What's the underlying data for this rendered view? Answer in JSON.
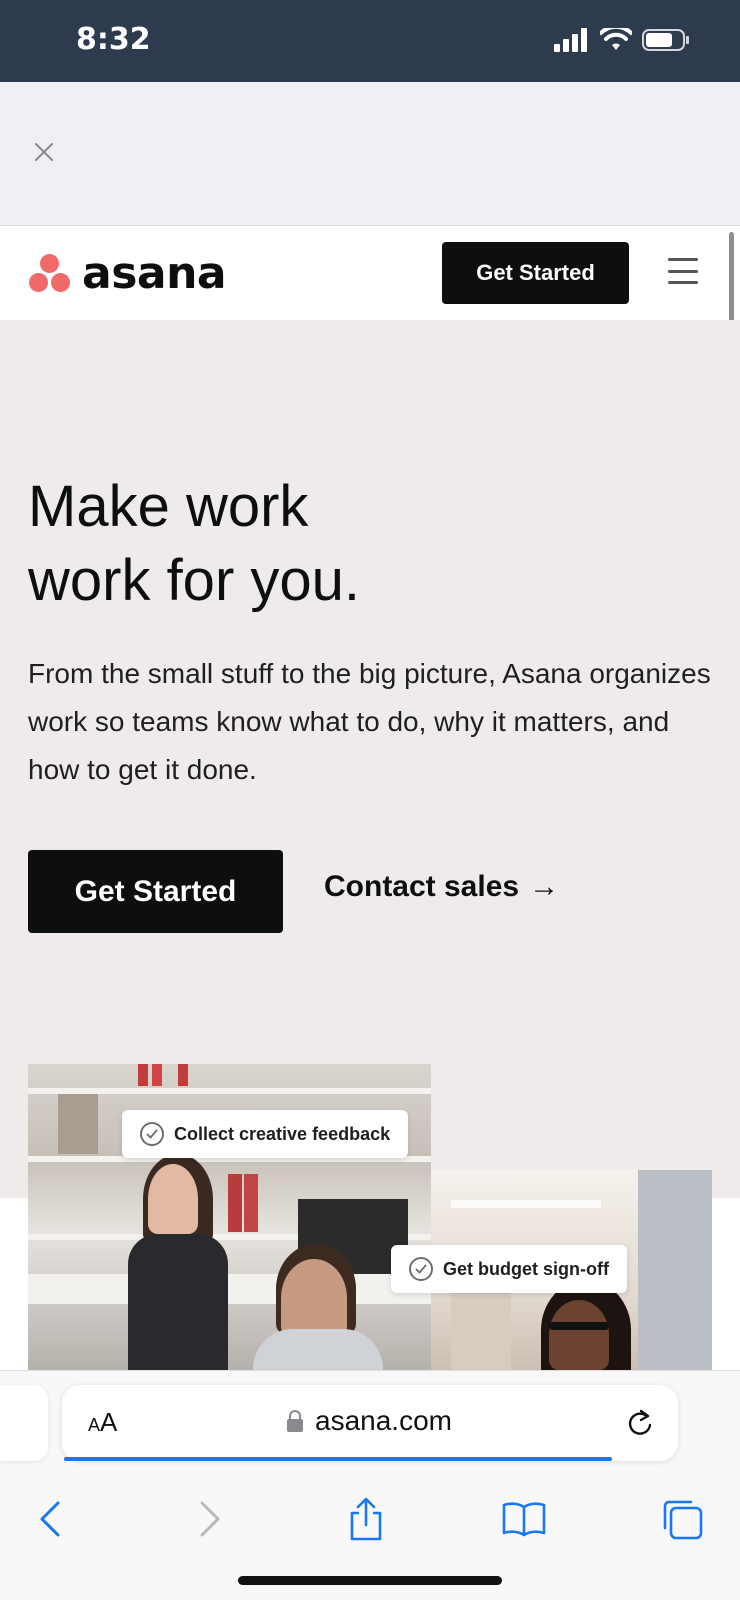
{
  "status_bar": {
    "time": "8:32"
  },
  "header": {
    "logo_text": "asana",
    "cta_label": "Get Started"
  },
  "hero": {
    "title_line1": "Make work",
    "title_line2": "work for you.",
    "body": "From the small stuff to the big picture, Asana organizes work so teams know what to do, why it matters, and how to get it done.",
    "cta_label": "Get Started",
    "contact_label": "Contact sales",
    "contact_arrow": "→"
  },
  "cards": {
    "chip1": "Collect creative feedback",
    "chip2": "Get budget sign-off"
  },
  "browser": {
    "aa_small": "A",
    "aa_large": "A",
    "url": "asana.com",
    "load_progress": 0.89
  },
  "colors": {
    "brand_coral": "#f06a6a",
    "dark": "#0d0e10",
    "hero_bg": "#efebea",
    "status_bar_bg": "#2e3b4e",
    "safari_blue": "#1877f2"
  },
  "icons": [
    "signal-icon",
    "wifi-icon",
    "battery-icon",
    "close-icon",
    "menu-icon",
    "check-circle-icon",
    "lock-icon",
    "reload-icon",
    "back-icon",
    "forward-icon",
    "share-icon",
    "bookmarks-icon",
    "tabs-icon"
  ]
}
